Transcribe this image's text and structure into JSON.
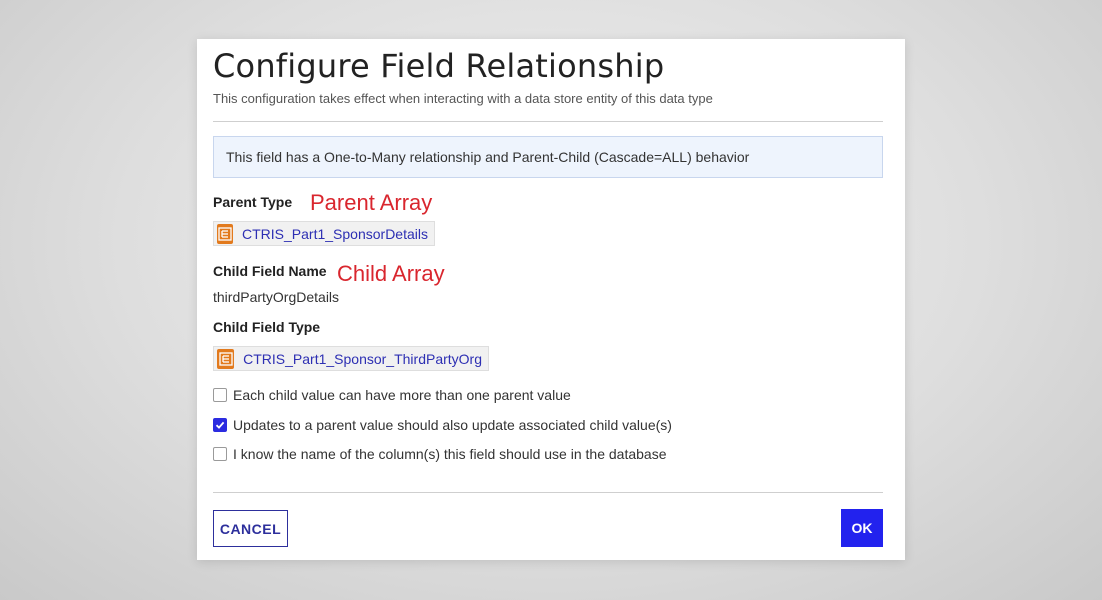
{
  "dialog": {
    "title": "Configure Field Relationship",
    "subtitle": "This configuration takes effect when interacting with a data store entity of this data type",
    "info": "This field has a One-to-Many relationship and Parent-Child (Cascade=ALL) behavior",
    "parent_type": {
      "label": "Parent Type",
      "annotation": "Parent Array",
      "value": "CTRIS_Part1_SponsorDetails",
      "icon": "data-type-icon"
    },
    "child_field_name": {
      "label": "Child Field Name",
      "annotation": "Child Array",
      "value": "thirdPartyOrgDetails"
    },
    "child_field_type": {
      "label": "Child Field Type",
      "value": "CTRIS_Part1_Sponsor_ThirdPartyOrg",
      "icon": "data-type-icon"
    },
    "options": [
      {
        "label": "Each child value can have more than one parent value",
        "checked": false
      },
      {
        "label": "Updates to a parent value should also update associated child value(s)",
        "checked": true
      },
      {
        "label": "I know the name of the column(s) this field should use in the database",
        "checked": false
      }
    ],
    "buttons": {
      "cancel": "CANCEL",
      "ok": "OK"
    }
  },
  "colors": {
    "accent": "#2222ee",
    "link": "#2d2fb3",
    "annotation": "#d9262e",
    "icon_bg": "#e27a1d"
  }
}
